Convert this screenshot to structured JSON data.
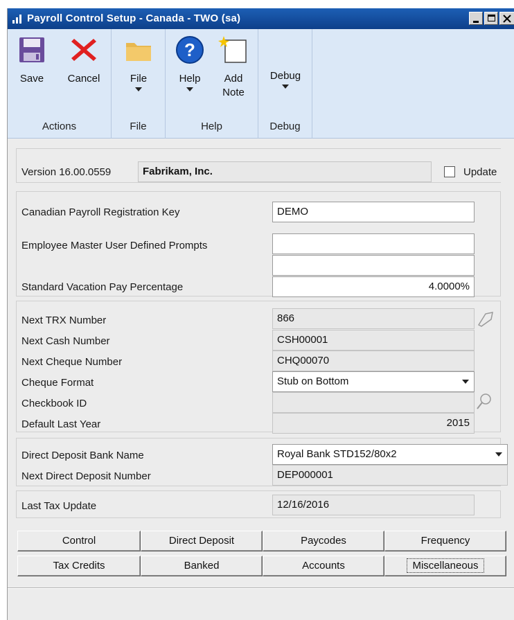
{
  "window": {
    "title": "Payroll Control Setup - Canada  -  TWO (sa)"
  },
  "ribbon": {
    "groups": [
      {
        "label": "Actions",
        "buttons": [
          {
            "label": "Save",
            "icon": "save-icon"
          },
          {
            "label": "Cancel",
            "icon": "cancel-icon"
          }
        ]
      },
      {
        "label": "File",
        "buttons": [
          {
            "label": "File",
            "icon": "folder-icon"
          }
        ]
      },
      {
        "label": "Help",
        "buttons": [
          {
            "label": "Help",
            "icon": "help-icon"
          },
          {
            "label": "Add",
            "label2": "Note",
            "icon": "add-note-icon"
          }
        ]
      },
      {
        "label": "Debug",
        "buttons": [
          {
            "label": "Debug"
          }
        ]
      }
    ]
  },
  "form": {
    "version_label": "Version 16.00.0559",
    "company": "Fabrikam, Inc.",
    "update_label": "Update",
    "registration_key_label": "Canadian Payroll Registration Key",
    "registration_key_value": "DEMO",
    "prompts_label": "Employee Master User Defined Prompts",
    "prompt1": "",
    "prompt2": "",
    "vacation_label": "Standard Vacation Pay Percentage",
    "vacation_value": "4.0000%",
    "next_trx_label": "Next TRX Number",
    "next_trx_value": "866",
    "next_cash_label": "Next Cash Number",
    "next_cash_value": "CSH00001",
    "next_cheque_label": "Next Cheque Number",
    "next_cheque_value": "CHQ00070",
    "cheque_format_label": "Cheque Format",
    "cheque_format_value": "Stub on Bottom",
    "checkbook_label": "Checkbook ID",
    "checkbook_value": "",
    "default_year_label": "Default Last Year",
    "default_year_value": "2015",
    "dd_bank_label": "Direct Deposit Bank Name",
    "dd_bank_value": "Royal Bank STD152/80x2",
    "next_dd_label": "Next Direct Deposit Number",
    "next_dd_value": "DEP000001",
    "last_tax_label": "Last Tax Update",
    "last_tax_value": "12/16/2016"
  },
  "tabs": [
    [
      "Control",
      "Direct Deposit",
      "Paycodes",
      "Frequency"
    ],
    [
      "Tax Credits",
      "Banked",
      "Accounts",
      "Miscellaneous"
    ]
  ],
  "colors": {
    "titlebar": "#0d3f8a",
    "ribbon": "#dbe8f7",
    "form_bg": "#ececec"
  }
}
